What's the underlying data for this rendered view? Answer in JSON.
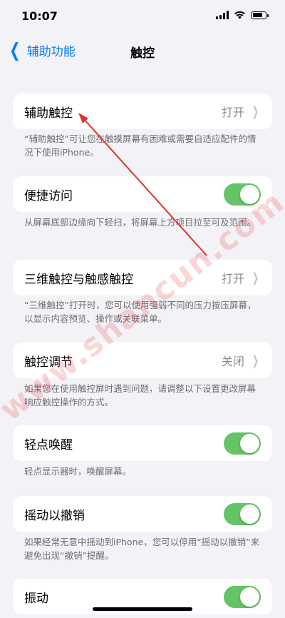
{
  "status_bar": {
    "time": "10:07"
  },
  "nav": {
    "back_label": "辅助功能",
    "title": "触控"
  },
  "rows": {
    "assistive_touch": {
      "label": "辅助触控",
      "value": "打开"
    },
    "reachability": {
      "label": "便捷访问",
      "toggle": "on"
    },
    "haptic_touch": {
      "label": "三维触控与触感触控",
      "value": "打开"
    },
    "touch_accommodations": {
      "label": "触控调节",
      "value": "关闭"
    },
    "tap_to_wake": {
      "label": "轻点唤醒",
      "toggle": "on"
    },
    "shake_to_undo": {
      "label": "摇动以撤销",
      "toggle": "on"
    },
    "vibration": {
      "label": "振动",
      "toggle": "on"
    }
  },
  "footnotes": {
    "assistive_touch": "“辅助触控”可让您在触摸屏幕有困难或需要自适应配件的情况下使用iPhone。",
    "reachability": "从屏幕底部边缘向下轻扫，将屏幕上方项目拉至可及范围。",
    "haptic_touch": "“三维触控”打开时，您可以使用强弱不同的压力按压屏幕，以显示内容预览、操作或关联菜单。",
    "touch_accommodations": "如果您在使用触控屏时遇到问题，请调整以下设置更改屏幕响应触控操作的方式。",
    "tap_to_wake": "轻点显示器时，唤醒屏幕。",
    "shake_to_undo": "如果经常无意中摇动到iPhone，您可以停用“摇动以撤销”来避免出现“撤销”提醒。"
  },
  "watermark": "www.shancun.com",
  "colors": {
    "accent": "#007aff",
    "toggle_on": "#65c466",
    "annotation_arrow": "#e0352b"
  }
}
